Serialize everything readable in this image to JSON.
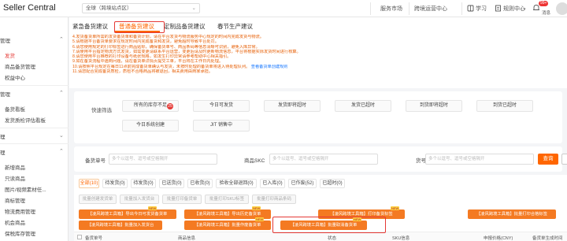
{
  "topbar": {
    "brand": "Seller Central",
    "region": "全球（跨境站点区）",
    "links": [
      "服务市场",
      "跨境运营中心"
    ],
    "study": "学习",
    "rules": "规则中心",
    "msg": "消息",
    "msg_badge": "99+"
  },
  "sidebar": {
    "items": [
      {
        "label": "管理"
      },
      {
        "label": "发货"
      },
      {
        "label": "商品备货管理"
      },
      {
        "label": "权益中心"
      },
      {
        "label": "管理"
      },
      {
        "label": "备货看板"
      },
      {
        "label": "发货质检评估看板"
      },
      {
        "label": "理"
      },
      {
        "label": "理"
      },
      {
        "label": "新增商品"
      },
      {
        "label": "只读商品"
      },
      {
        "label": "图片/视频素材任..."
      },
      {
        "label": "商标管理"
      },
      {
        "label": "物流费用管理"
      },
      {
        "label": "机会商品"
      },
      {
        "label": "保税库存管理"
      }
    ]
  },
  "tabs": {
    "items": [
      "紧急备货建议",
      "普通备货建议",
      "定制品备货建议",
      "春节生产建议"
    ]
  },
  "notice": {
    "lines": [
      "4.发货备货单所需的发货备货单和备货计划，请在平台发货与物流服务中心规定的时间内完成发货与物流。",
      "5.请根据平台备货单要求在规定时间内完成备货和发货，避免超时导致平台处罚。",
      "6.请您使用规定的打印标签进行商品贴标，确保备货单号、商品条码等信息清晰可识别，避免入库异常。",
      "7.请使用平台指定物流方式发货，如需变更请联系平台运营，变更后请及时更新物流信息，平台将根据实际发货时间进行核算。",
      "8.请您使用平台推荐的打印设备与纸张规格，如发生打印异常请参考帮助中心相关指引。",
      "9.如在备货流程中遇到问题，请在备货单详情页提交工单，平台将在工作日内处理。",
      "10.请按照平台规定在每日11点前完成备货单确认与发货，未按时处理的备货单将进入待处理队列。",
      "11.请您配合完成备货质检，质检不合格商品将被退回，相关费用由商家承担。"
    ],
    "link": "查看备货单创建规则"
  },
  "filter": {
    "label": "快速筛选",
    "chips": [
      {
        "label": "所有的库存不足",
        "count": "25"
      },
      {
        "label": "今日可发货"
      },
      {
        "label": "发货即将超时"
      },
      {
        "label": "发货已超时"
      },
      {
        "label": "到货即将超时"
      },
      {
        "label": "到货已超时"
      },
      {
        "label": "今日系统创建"
      },
      {
        "label": "JIT 销售中"
      }
    ]
  },
  "search": {
    "fields": [
      {
        "label": "备货单号",
        "placeholder": "多个以逗号、逗号或空格隔开"
      },
      {
        "label": "商品SKC",
        "placeholder": "多个以逗号、逗号或空格隔开"
      },
      {
        "label": "货号",
        "placeholder": "多个以逗号、逗号或空格隔开"
      }
    ],
    "button": "查询"
  },
  "status_tabs": {
    "items": [
      "全部(10)",
      "待发货(0)",
      "待发货(0)",
      "已送货(0)",
      "已收货(0)",
      "验收全部退回(0)",
      "已入库(0)",
      "已作废(52)",
      "已超时(0)"
    ]
  },
  "actions": {
    "grey": [
      "批量创建发货单",
      "批量加入发货台",
      "批量打印备货单",
      "批量打印SKU标签",
      "批量打印商品条码"
    ],
    "orange": [
      {
        "label": "【凌风跨境工具箱】导出今日可发货备货单"
      },
      {
        "label": "【凌风跨境工具箱】导出历史备货单"
      },
      {
        "label": "【凌风跨境工具箱】打印备货标签"
      },
      {
        "label": "【凌风跨境工具箱】批量打印合格标签"
      },
      {
        "label": "【凌风跨境工具箱】批量加入发货台"
      },
      {
        "label": "【凌风跨境工具箱】批量作废备货单"
      },
      {
        "label": "【凌风跨境工具箱】批量取消备货单"
      }
    ],
    "new_tag": "NEW"
  },
  "table": {
    "headers": [
      "备货单号",
      "商品信息",
      "状态",
      "SKU信息",
      "申报价格(CNY)",
      "备货单生成时间"
    ]
  }
}
